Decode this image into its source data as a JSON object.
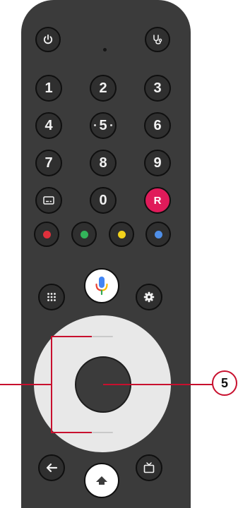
{
  "remote": {
    "number_buttons": [
      "1",
      "2",
      "3",
      "4",
      "5",
      "6",
      "7",
      "8",
      "9",
      "0"
    ],
    "record_label": "R",
    "color_buttons": [
      "#e0303c",
      "#33b35a",
      "#f2d21b",
      "#4f8fe8"
    ],
    "icons": {
      "power": "power-icon",
      "diagnostics": "stethoscope-icon",
      "subtitles": "subtitles-icon",
      "apps": "apps-grid-icon",
      "assistant": "microphone-icon",
      "settings": "gear-icon",
      "back": "back-arrow-icon",
      "home": "home-icon",
      "tv": "tv-icon"
    }
  },
  "callout": {
    "label": "5"
  },
  "colors": {
    "remote_body": "#3b3b3b",
    "button": "#2f2f2f",
    "dpad_ring": "#e8e8e8",
    "record": "#e01b5a",
    "callout_line": "#c8102e"
  }
}
